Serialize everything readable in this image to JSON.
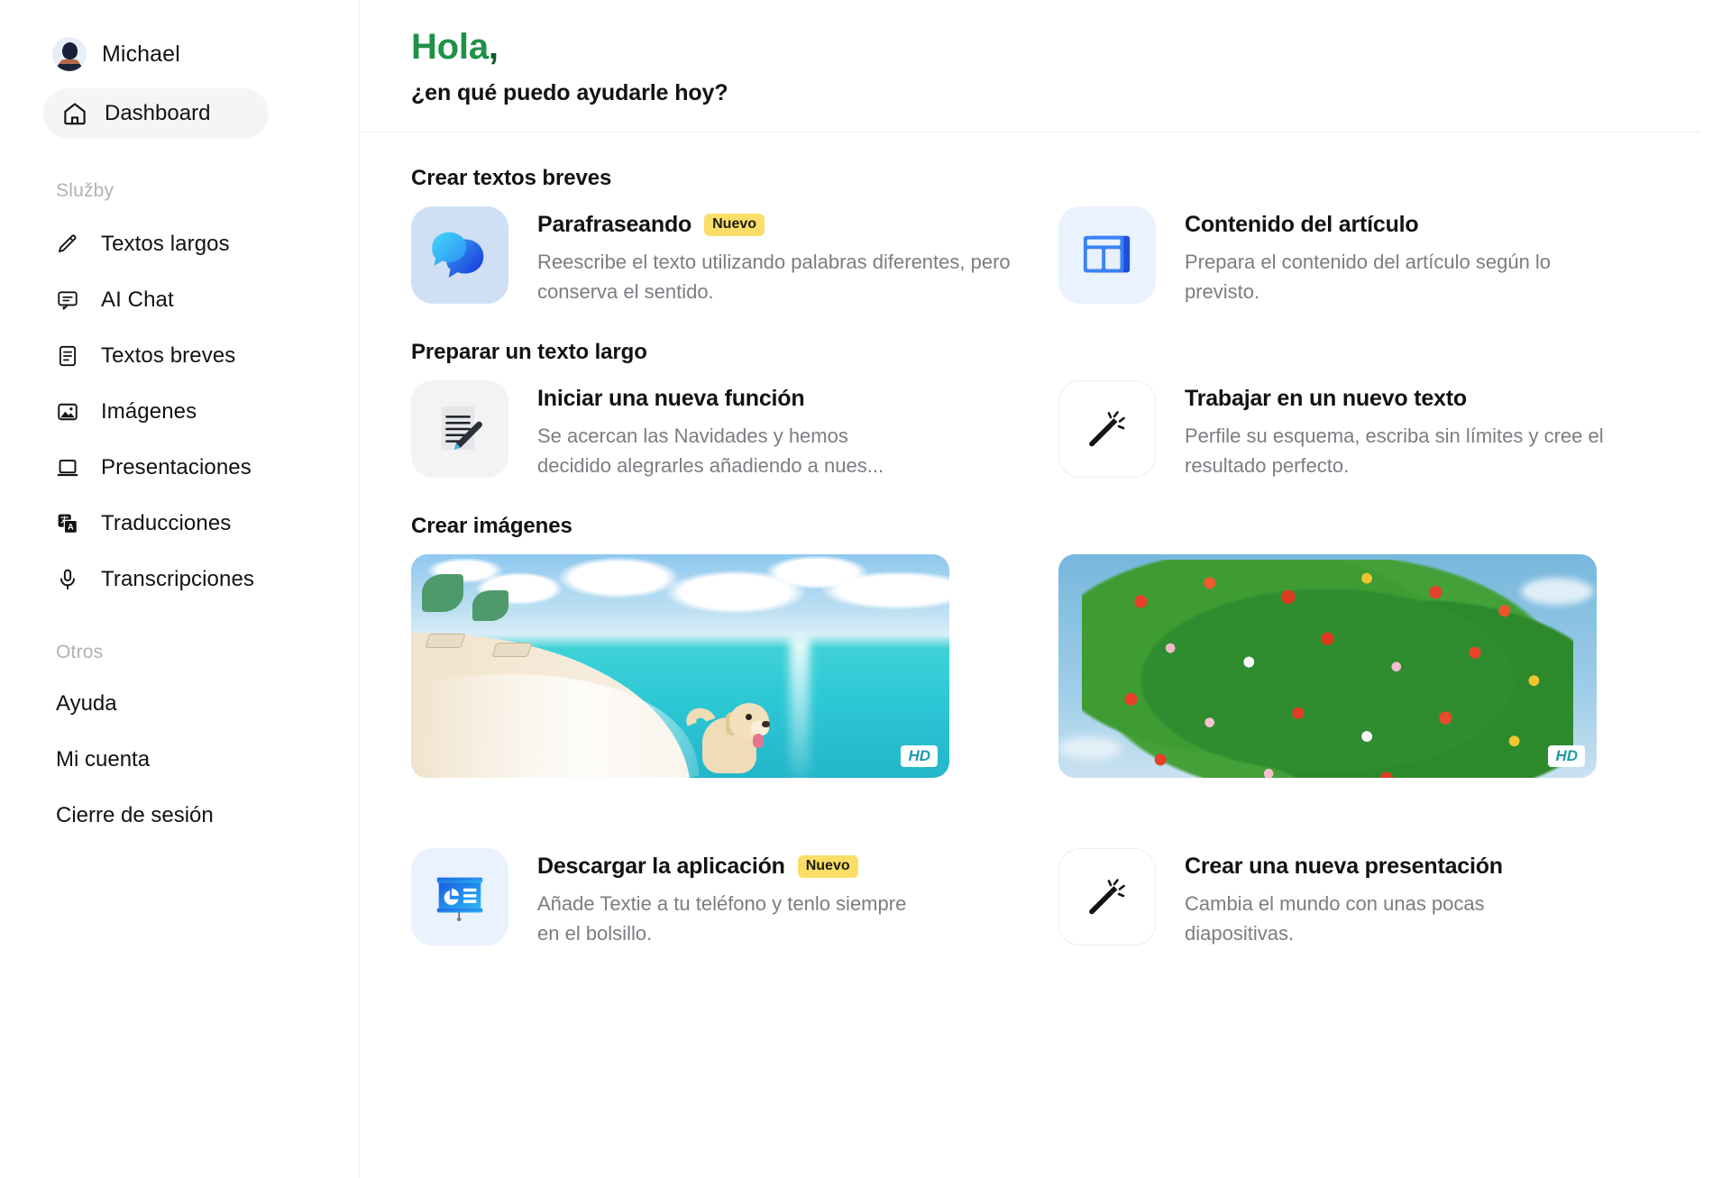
{
  "sidebar": {
    "user": {
      "name": "Michael",
      "avatar_icon": "user-avatar-icon"
    },
    "dashboard": {
      "label": "Dashboard",
      "icon": "home-icon"
    },
    "services_group_title": "Služby",
    "services": [
      {
        "label": "Textos largos",
        "icon": "pencil-icon"
      },
      {
        "label": "AI Chat",
        "icon": "chat-bubble-icon"
      },
      {
        "label": "Textos breves",
        "icon": "document-lines-icon"
      },
      {
        "label": "Imágenes",
        "icon": "image-icon"
      },
      {
        "label": "Presentaciones",
        "icon": "laptop-icon"
      },
      {
        "label": "Traducciones",
        "icon": "translate-icon"
      },
      {
        "label": "Transcripciones",
        "icon": "microphone-icon"
      }
    ],
    "others_group_title": "Otros",
    "others": [
      {
        "label": "Ayuda"
      },
      {
        "label": "Mi cuenta"
      },
      {
        "label": "Cierre de sesión"
      }
    ]
  },
  "header": {
    "greeting": "Hola",
    "greeting_comma": ",",
    "subtitle": "¿en qué puedo ayudarle hoy?"
  },
  "sections": {
    "short_texts": {
      "label": "Crear textos breves",
      "cards": [
        {
          "title": "Parafraseando",
          "badge": "Nuevo",
          "desc": "Reescribe el texto utilizando palabras diferentes, pero conserva el sentido.",
          "icon": "speech-bubbles-icon"
        },
        {
          "title": "Contenido del artículo",
          "badge": "",
          "desc": "Prepara el contenido del artículo según lo previsto.",
          "icon": "article-layout-icon"
        }
      ]
    },
    "long_text": {
      "label": "Preparar un texto largo",
      "cards": [
        {
          "title": "Iniciar una nueva función",
          "badge": "",
          "desc": "Se acercan las Navidades y hemos decidido alegrarles añadiendo a nues...",
          "icon": "document-pencil-icon"
        },
        {
          "title": "Trabajar en un nuevo texto",
          "badge": "",
          "desc": "Perfile su esquema, escriba sin límites y cree el resultado perfecto.",
          "icon": "magic-wand-icon"
        }
      ]
    },
    "images": {
      "label": "Crear imágenes",
      "items": [
        {
          "alt": "Perro en una playa tropical",
          "quality_badge": "HD"
        },
        {
          "alt": "Arbusto con flores rojas y amarillas",
          "quality_badge": "HD"
        }
      ]
    },
    "bottom": {
      "cards": [
        {
          "title": "Descargar la aplicación",
          "badge": "Nuevo",
          "desc": "Añade Textie a tu teléfono y tenlo siempre en el bolsillo.",
          "icon": "presentation-board-icon"
        },
        {
          "title": "Crear una nueva presentación",
          "badge": "",
          "desc": "Cambia el mundo con unas pocas diapositivas.",
          "icon": "magic-wand-icon"
        }
      ]
    }
  },
  "colors": {
    "accent_green": "#1f9149",
    "badge_yellow": "#fade68",
    "hd_teal": "#1f9aa8",
    "text_primary": "#111214",
    "text_muted": "#7b7d83"
  }
}
